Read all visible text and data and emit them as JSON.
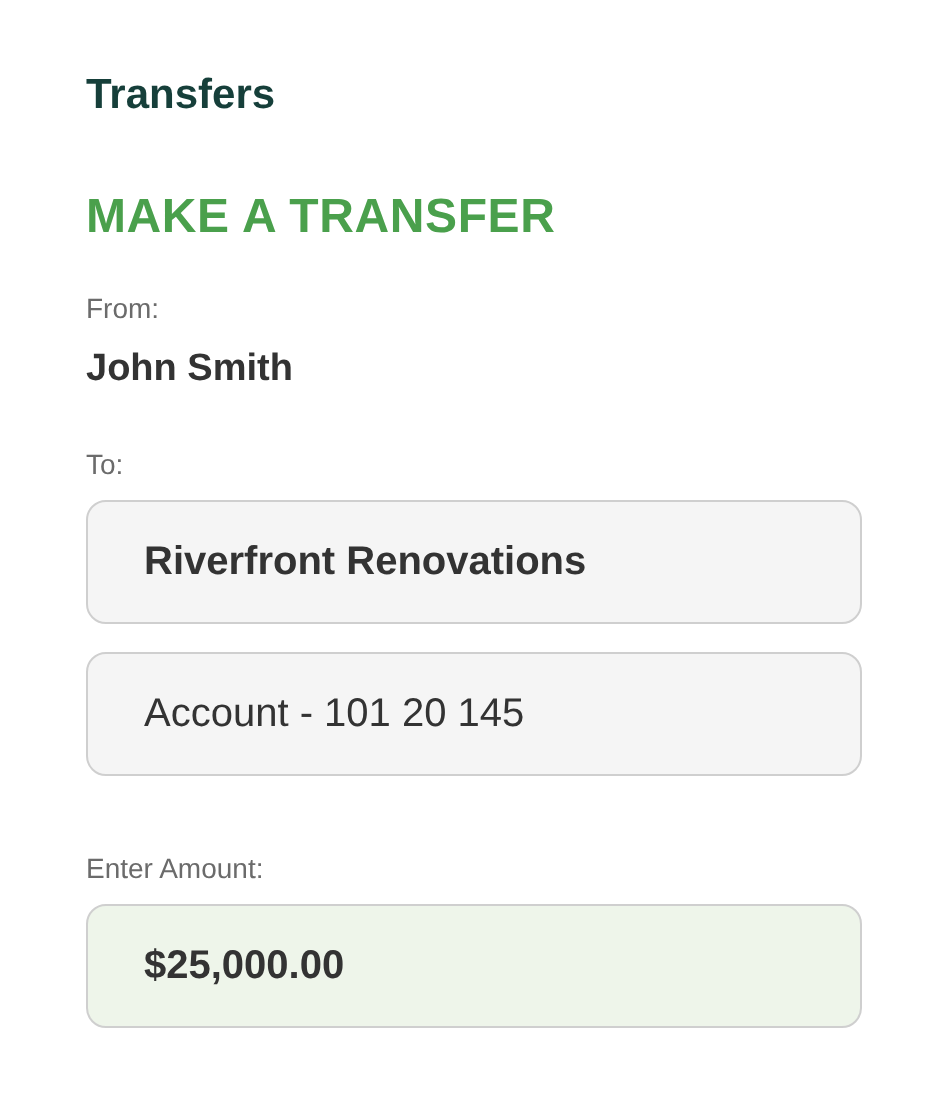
{
  "header": {
    "title": "Transfers"
  },
  "form": {
    "heading": "MAKE A TRANSFER",
    "from": {
      "label": "From:",
      "value": "John Smith"
    },
    "to": {
      "label": "To:",
      "fields": [
        {
          "kind": "payee",
          "value": "Riverfront Renovations"
        },
        {
          "kind": "account",
          "value": "Account - 101 20 145"
        }
      ]
    },
    "amount": {
      "label": "Enter Amount:",
      "value": "$25,000.00"
    }
  }
}
